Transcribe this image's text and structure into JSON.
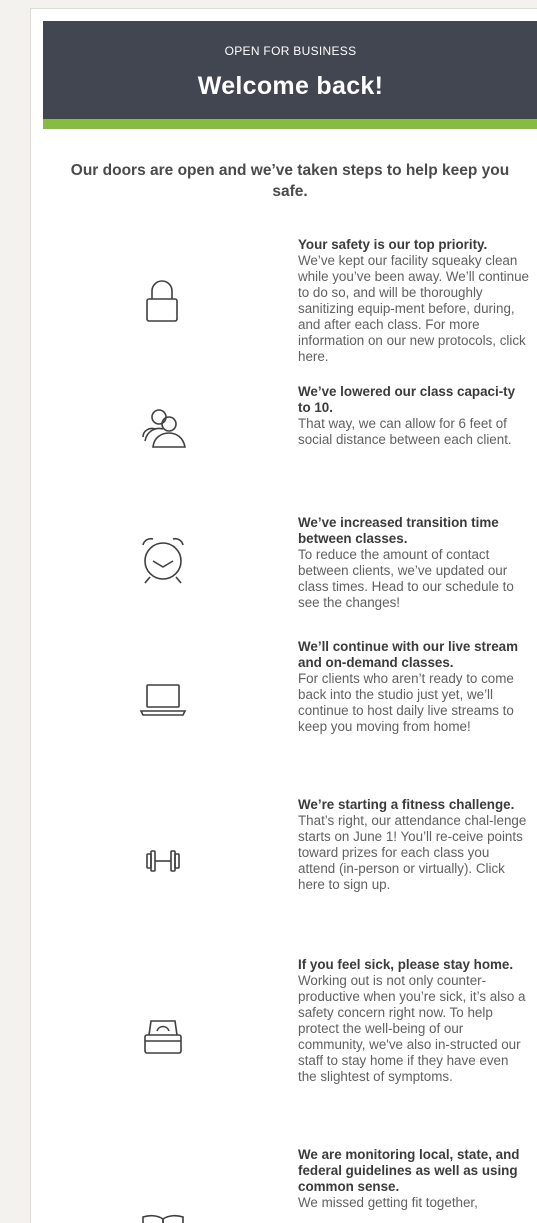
{
  "header": {
    "eyebrow": "OPEN FOR BUSINESS",
    "title": "Welcome back!"
  },
  "intro": "Our doors are open and we’ve taken steps to help keep you safe.",
  "colors": {
    "header_bg": "#424650",
    "accent": "#86bc43"
  },
  "items": [
    {
      "icon": "lock-icon",
      "heading": "Your safety is our top priority.",
      "body": "We’ve kept our facility squeaky clean while you’ve been away. We’ll continue to do so, and will be thoroughly sanitizing equip-ment before, during, and after each class. For more information on our new protocols, click here."
    },
    {
      "icon": "group-icon",
      "heading": "We’ve lowered our class capaci-ty to 10.",
      "body": "That way, we can allow for 6 feet of social distance between each client."
    },
    {
      "icon": "alarm-clock-icon",
      "heading": "We’ve increased transition time between classes.",
      "body": "To reduce the amount of contact between clients, we’ve updated our class times. Head to our schedule to see the changes!"
    },
    {
      "icon": "laptop-icon",
      "heading": "We’ll continue with our live stream and on-demand classes.",
      "body": "For clients who aren’t ready to come back into the studio just yet, we’ll continue to host daily live streams to keep you moving from home!"
    },
    {
      "icon": "dumbbell-icon",
      "heading": "We’re starting a fitness challenge.",
      "body": "That’s right, our attendance chal-lenge starts on June 1! You’ll re-ceive points toward prizes for each class you attend (in-person or virtually). Click here to sign up."
    },
    {
      "icon": "tissue-box-icon",
      "heading": "If you feel sick, please stay home.",
      "body": "Working out is not only counter-productive when you’re sick, it’s also a safety concern right now. To help protect the well-being of our community, we've also in-structed our staff to stay home if they have even the slightest of symptoms."
    },
    {
      "icon": "book-icon",
      "heading": "We are monitoring local, state, and federal guidelines as well as using common sense.",
      "body": "We missed getting fit together,"
    }
  ]
}
